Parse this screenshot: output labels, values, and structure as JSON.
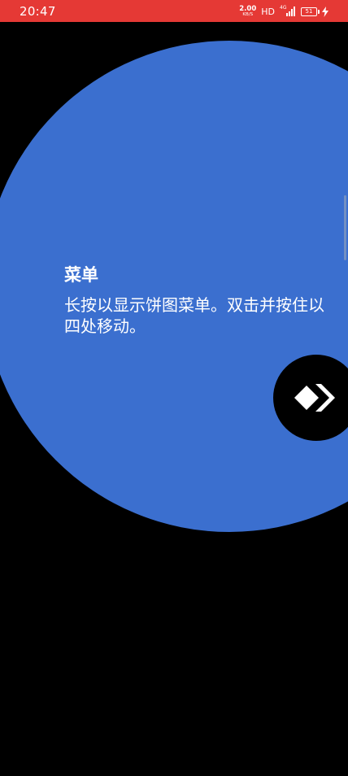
{
  "status_bar": {
    "time": "20:47",
    "net_speed_value": "2.00",
    "net_speed_unit": "KB/S",
    "hd_label": "HD",
    "network_type": "4G",
    "battery_level": "51",
    "charging": true,
    "background_color": "#e53935"
  },
  "tooltip": {
    "title": "菜单",
    "description": "长按以显示饼图菜单。双击并按住以四处移动。",
    "highlight_color": "#3b6fcf"
  },
  "floating_button": {
    "icon": "anydesk-logo-icon",
    "background_color": "#000000"
  }
}
